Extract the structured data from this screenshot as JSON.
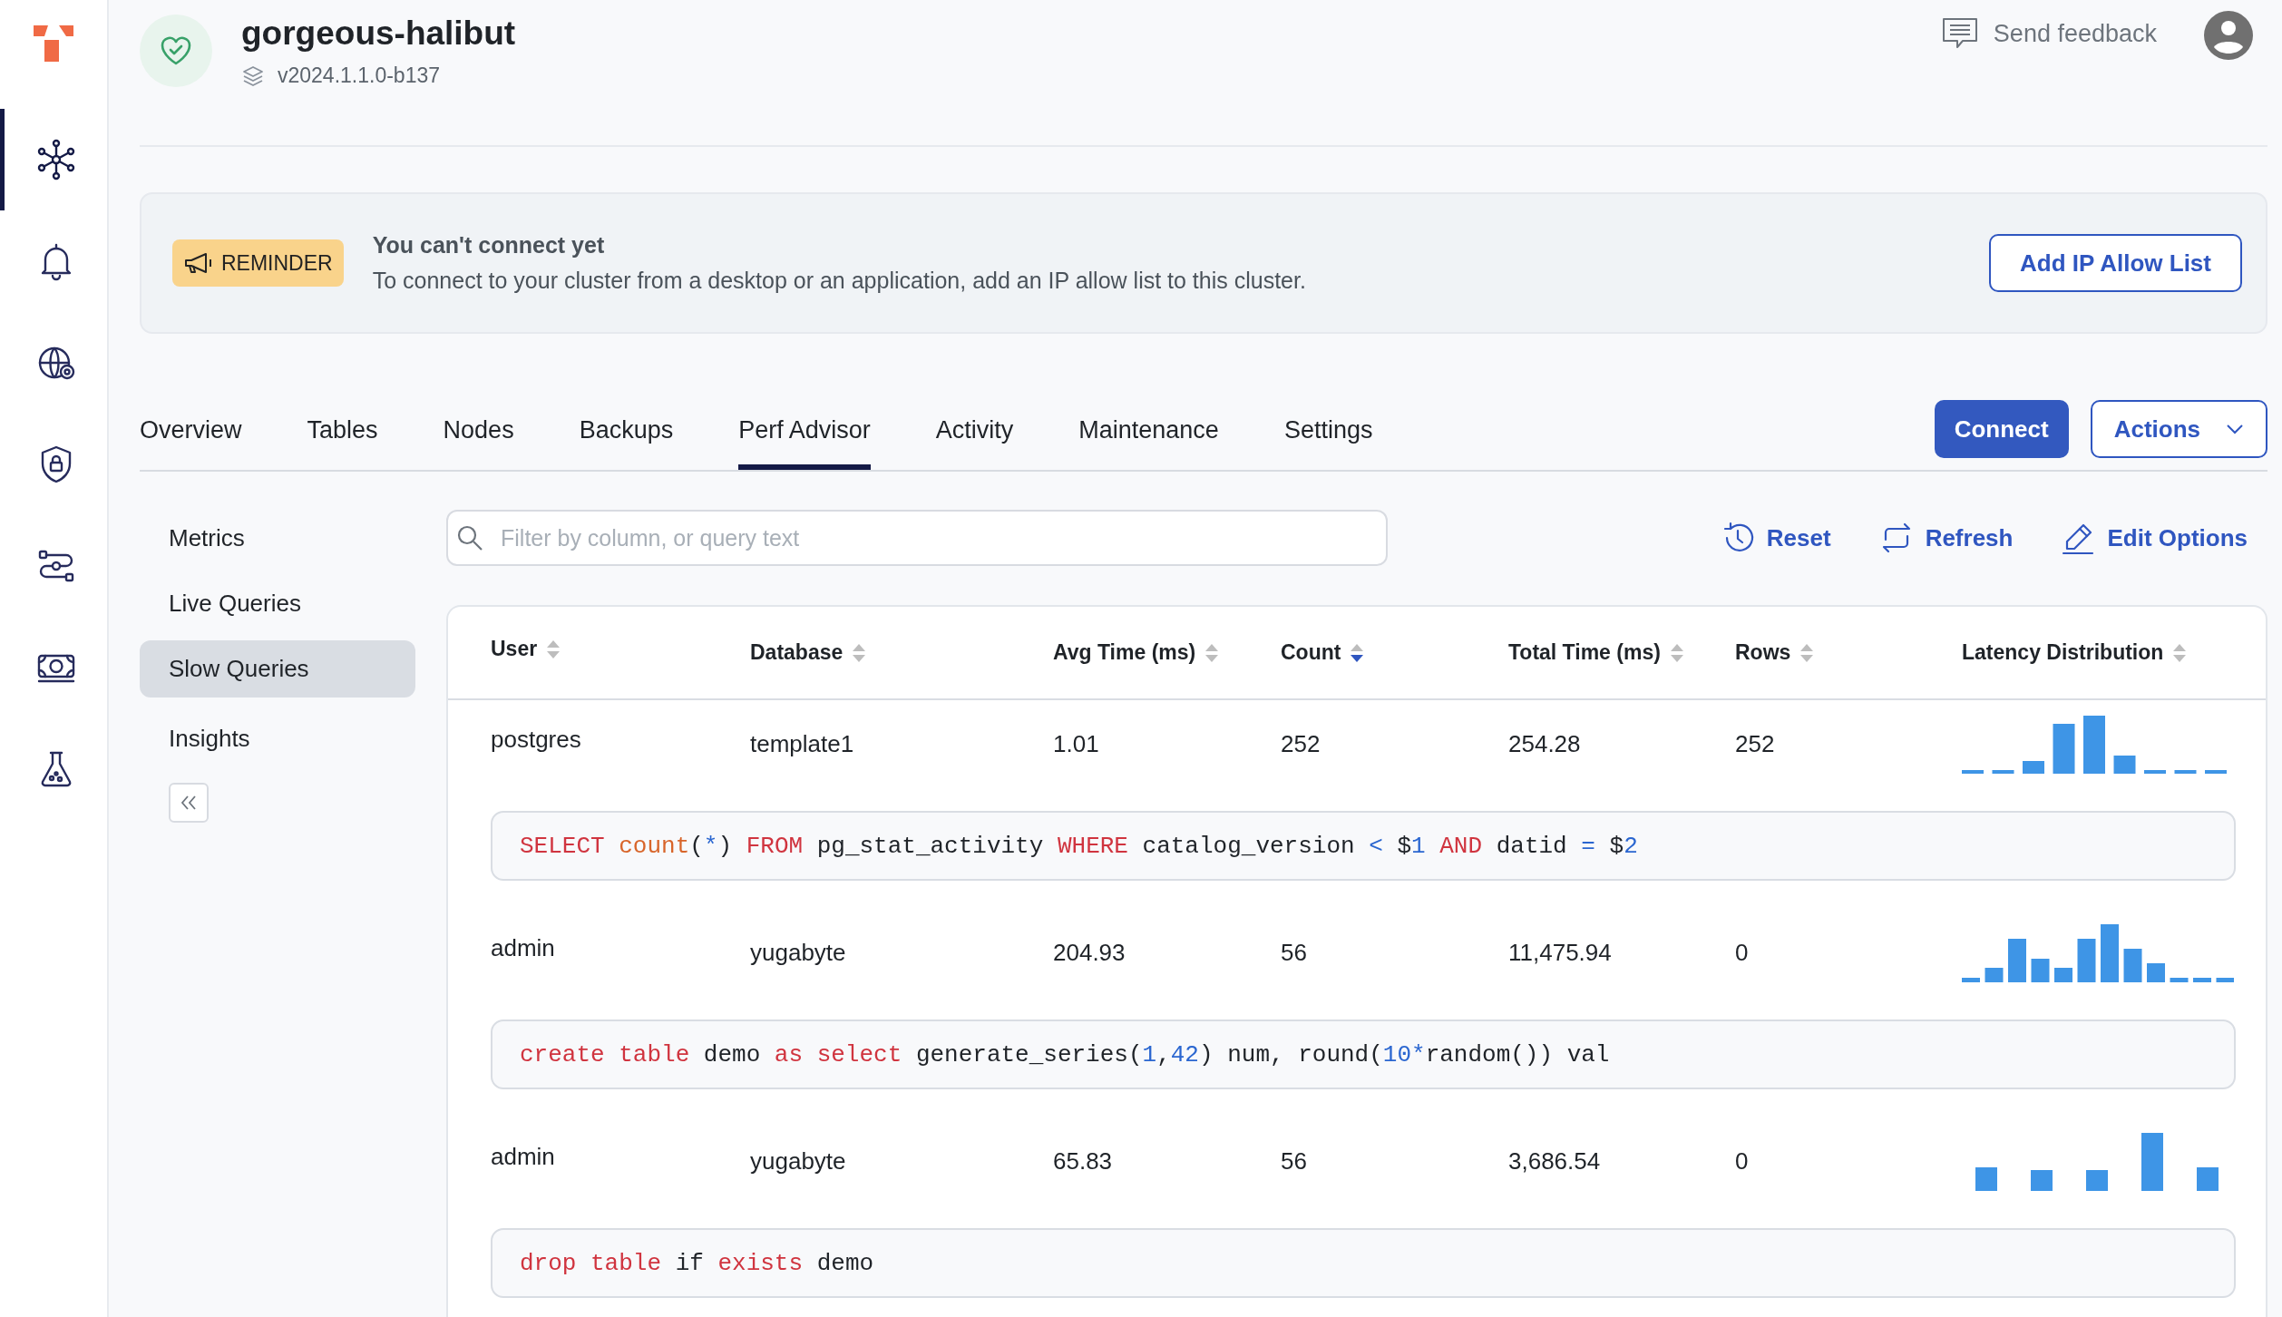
{
  "nav_rail": [
    {
      "selected": true
    },
    {
      "selected": false
    },
    {
      "selected": false
    },
    {
      "selected": false
    },
    {
      "selected": false
    },
    {
      "selected": false
    },
    {
      "selected": false
    }
  ],
  "header": {
    "cluster_name": "gorgeous-halibut",
    "version": "v2024.1.1.0-b137",
    "feedback": "Send feedback"
  },
  "banner": {
    "badge": "REMINDER",
    "title": "You can't connect yet",
    "message": "To connect to your cluster from a desktop or an application, add an IP allow list to this cluster.",
    "button": "Add IP Allow List"
  },
  "tabs": [
    {
      "label": "Overview",
      "selected": false
    },
    {
      "label": "Tables",
      "selected": false
    },
    {
      "label": "Nodes",
      "selected": false
    },
    {
      "label": "Backups",
      "selected": false
    },
    {
      "label": "Perf Advisor",
      "selected": true
    },
    {
      "label": "Activity",
      "selected": false
    },
    {
      "label": "Maintenance",
      "selected": false
    },
    {
      "label": "Settings",
      "selected": false
    }
  ],
  "tab_actions": {
    "connect": "Connect",
    "actions": "Actions"
  },
  "sub_nav": [
    {
      "label": "Metrics",
      "selected": false
    },
    {
      "label": "Live Queries",
      "selected": false
    },
    {
      "label": "Slow Queries",
      "selected": true
    },
    {
      "label": "Insights",
      "selected": false
    }
  ],
  "filter": {
    "placeholder": "Filter by column, or query text"
  },
  "toolbar": [
    {
      "kind": "reset",
      "label": "Reset"
    },
    {
      "kind": "refresh",
      "label": "Refresh"
    },
    {
      "kind": "edit",
      "label": "Edit Options"
    }
  ],
  "table": {
    "columns": [
      {
        "label": "User",
        "sorted": false
      },
      {
        "label": "Database",
        "sorted": false
      },
      {
        "label": "Avg Time (ms)",
        "sorted": false
      },
      {
        "label": "Count",
        "sorted": true
      },
      {
        "label": "Total Time (ms)",
        "sorted": false
      },
      {
        "label": "Rows",
        "sorted": false
      },
      {
        "label": "Latency Distribution",
        "sorted": false
      }
    ],
    "rows": [
      {
        "cells": [
          "postgres",
          "template1",
          "1.01",
          "252",
          "254.28",
          "252"
        ],
        "query": [
          {
            "text": "SELECT ",
            "kind": "keyword"
          },
          {
            "text": "count",
            "kind": "function"
          },
          {
            "text": "(",
            "kind": "plain"
          },
          {
            "text": "*",
            "kind": "operator"
          },
          {
            "text": ") ",
            "kind": "plain"
          },
          {
            "text": "FROM ",
            "kind": "keyword"
          },
          {
            "text": "pg_stat_activity ",
            "kind": "plain"
          },
          {
            "text": "WHERE ",
            "kind": "keyword"
          },
          {
            "text": "catalog_version ",
            "kind": "plain"
          },
          {
            "text": "<",
            "kind": "operator"
          },
          {
            "text": " $",
            "kind": "plain"
          },
          {
            "text": "1 ",
            "kind": "number"
          },
          {
            "text": "AND ",
            "kind": "keyword"
          },
          {
            "text": "datid ",
            "kind": "plain"
          },
          {
            "text": "=",
            "kind": "operator"
          },
          {
            "text": " $",
            "kind": "plain"
          },
          {
            "text": "2",
            "kind": "number"
          }
        ]
      },
      {
        "cells": [
          "admin",
          "yugabyte",
          "204.93",
          "56",
          "11,475.94",
          "0"
        ],
        "query": [
          {
            "text": "create table ",
            "kind": "keyword"
          },
          {
            "text": "demo ",
            "kind": "plain"
          },
          {
            "text": "as select ",
            "kind": "keyword"
          },
          {
            "text": "generate_series(",
            "kind": "plain"
          },
          {
            "text": "1",
            "kind": "number"
          },
          {
            "text": ",",
            "kind": "plain"
          },
          {
            "text": "42",
            "kind": "number"
          },
          {
            "text": ") num, round(",
            "kind": "plain"
          },
          {
            "text": "10",
            "kind": "number"
          },
          {
            "text": "*",
            "kind": "operator"
          },
          {
            "text": "random()) val",
            "kind": "plain"
          }
        ]
      },
      {
        "cells": [
          "admin",
          "yugabyte",
          "65.83",
          "56",
          "3,686.54",
          "0"
        ],
        "query": [
          {
            "text": "drop table ",
            "kind": "keyword"
          },
          {
            "text": "if ",
            "kind": "plain"
          },
          {
            "text": "exists ",
            "kind": "keyword"
          },
          {
            "text": "demo",
            "kind": "plain"
          }
        ]
      }
    ]
  }
}
